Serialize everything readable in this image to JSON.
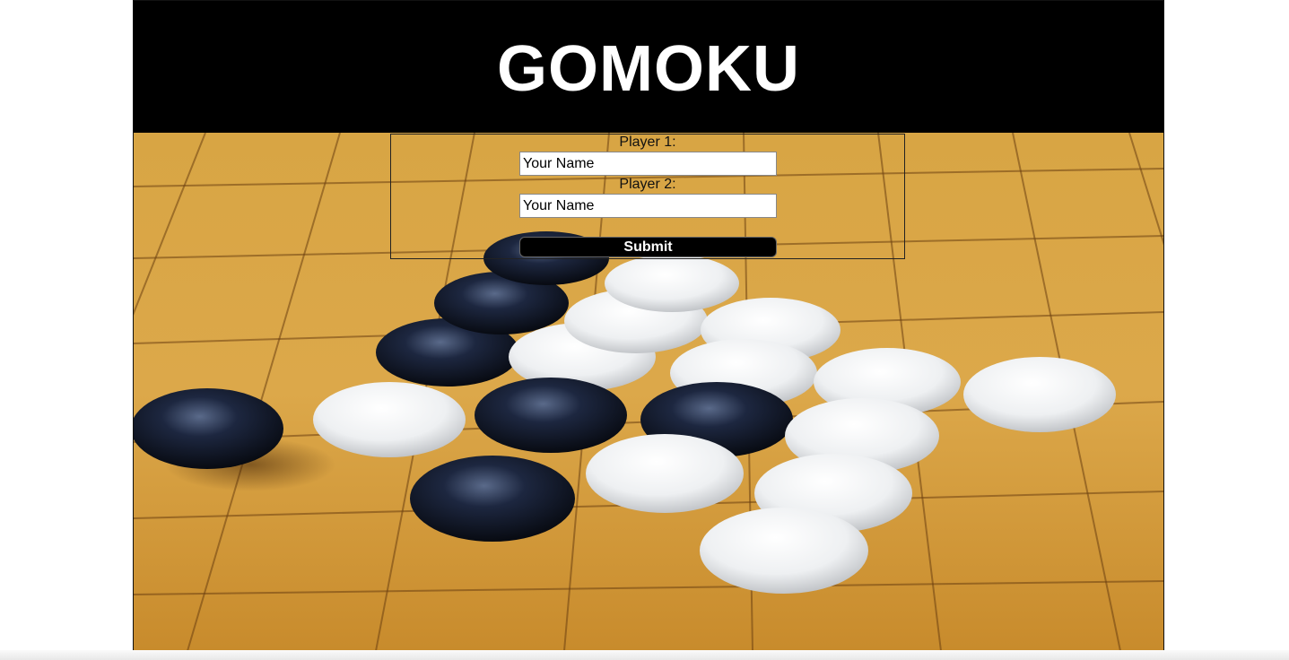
{
  "header": {
    "title": "GOMOKU"
  },
  "background": {
    "icon": "go-board-stones-image"
  },
  "form": {
    "player1_label": "Player 1:",
    "player1_value": "Your Name",
    "player2_label": "Player 2:",
    "player2_value": "Your Name",
    "submit_label": "Submit"
  },
  "colors": {
    "header_bg": "#000000",
    "title": "#ffffff",
    "board_wood": "#d9a443",
    "button_bg": "#000000"
  }
}
